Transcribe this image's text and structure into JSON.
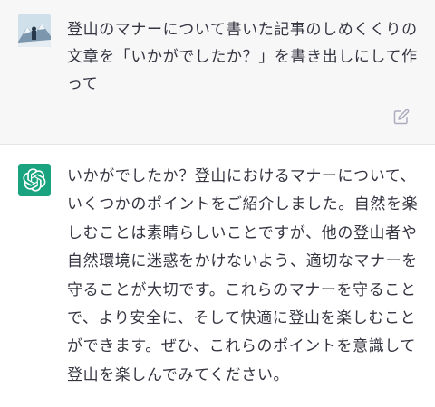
{
  "user_message": {
    "text": "登山のマナーについて書いた記事のしめくくりの文章を「いかがでしたか？」を書き出しにして作って"
  },
  "assistant_message": {
    "text": "いかがでしたか？登山におけるマナーについて、いくつかのポイントをご紹介しました。自然を楽しむことは素晴らしいことですが、他の登山者や自然環境に迷惑をかけないよう、適切なマナーを守ることが大切です。これらのマナーを守ることで、より安全に、そして快適に登山を楽しむことができます。ぜひ、これらのポイントを意識して登山を楽しんでみてください。"
  },
  "icons": {
    "user_avatar": "user-photo-avatar",
    "assistant_avatar": "openai-logo-icon",
    "edit": "edit-icon"
  },
  "colors": {
    "user_bg": "#f7f7f8",
    "assistant_avatar_bg": "#19a37f",
    "text": "#343541"
  }
}
